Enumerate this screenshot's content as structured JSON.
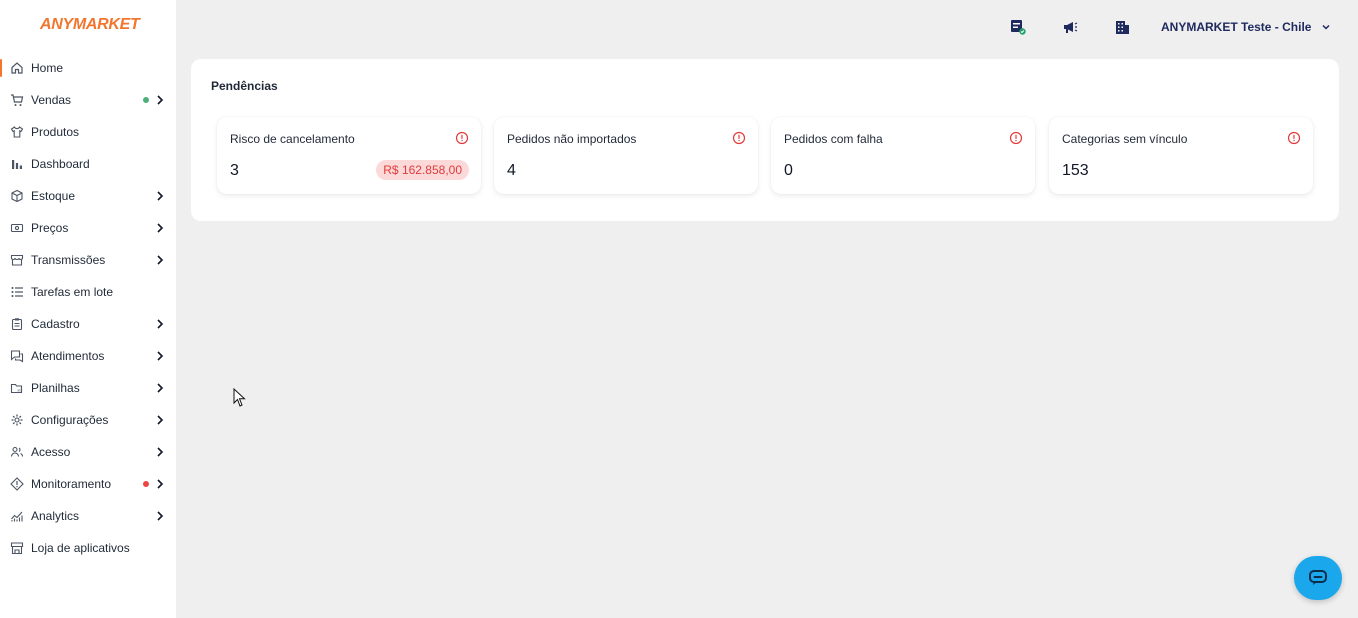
{
  "app": {
    "logo": "ANYMARKET"
  },
  "sidebar": {
    "items": [
      {
        "label": "Home",
        "icon": "home-icon",
        "active": true,
        "chevron": false,
        "dot": null
      },
      {
        "label": "Vendas",
        "icon": "cart-icon",
        "active": false,
        "chevron": true,
        "dot": "#4caf7a"
      },
      {
        "label": "Produtos",
        "icon": "shirt-icon",
        "active": false,
        "chevron": false,
        "dot": null
      },
      {
        "label": "Dashboard",
        "icon": "bar-chart-icon",
        "active": false,
        "chevron": false,
        "dot": null
      },
      {
        "label": "Estoque",
        "icon": "box-icon",
        "active": false,
        "chevron": true,
        "dot": null
      },
      {
        "label": "Preços",
        "icon": "money-icon",
        "active": false,
        "chevron": true,
        "dot": null
      },
      {
        "label": "Transmissões",
        "icon": "store-icon",
        "active": false,
        "chevron": true,
        "dot": null
      },
      {
        "label": "Tarefas em lote",
        "icon": "list-icon",
        "active": false,
        "chevron": false,
        "dot": null
      },
      {
        "label": "Cadastro",
        "icon": "clipboard-icon",
        "active": false,
        "chevron": true,
        "dot": null
      },
      {
        "label": "Atendimentos",
        "icon": "chat-icon",
        "active": false,
        "chevron": true,
        "dot": null
      },
      {
        "label": "Planilhas",
        "icon": "spreadsheet-icon",
        "active": false,
        "chevron": true,
        "dot": null
      },
      {
        "label": "Configurações",
        "icon": "gear-icon",
        "active": false,
        "chevron": true,
        "dot": null
      },
      {
        "label": "Acesso",
        "icon": "users-icon",
        "active": false,
        "chevron": true,
        "dot": null
      },
      {
        "label": "Monitoramento",
        "icon": "diamond-alert-icon",
        "active": false,
        "chevron": true,
        "dot": "#ef4444"
      },
      {
        "label": "Analytics",
        "icon": "analytics-icon",
        "active": false,
        "chevron": true,
        "dot": null
      },
      {
        "label": "Loja de aplicativos",
        "icon": "shop-icon",
        "active": false,
        "chevron": false,
        "dot": null
      }
    ]
  },
  "header": {
    "icons": [
      "server-status-icon",
      "megaphone-icon",
      "building-icon"
    ],
    "account_name": "ANYMARKET Teste - Chile"
  },
  "pendencias": {
    "title": "Pendências",
    "cards": [
      {
        "label": "Risco de cancelamento",
        "value": "3",
        "badge": "R$ 162.858,00"
      },
      {
        "label": "Pedidos não importados",
        "value": "4",
        "badge": null
      },
      {
        "label": "Pedidos com falha",
        "value": "0",
        "badge": null
      },
      {
        "label": "Categorias sem vínculo",
        "value": "153",
        "badge": null
      }
    ]
  },
  "colors": {
    "accent": "#f2762e",
    "navy": "#1e2a5e",
    "alert": "#e23b3b",
    "chat": "#1aa7ec"
  }
}
